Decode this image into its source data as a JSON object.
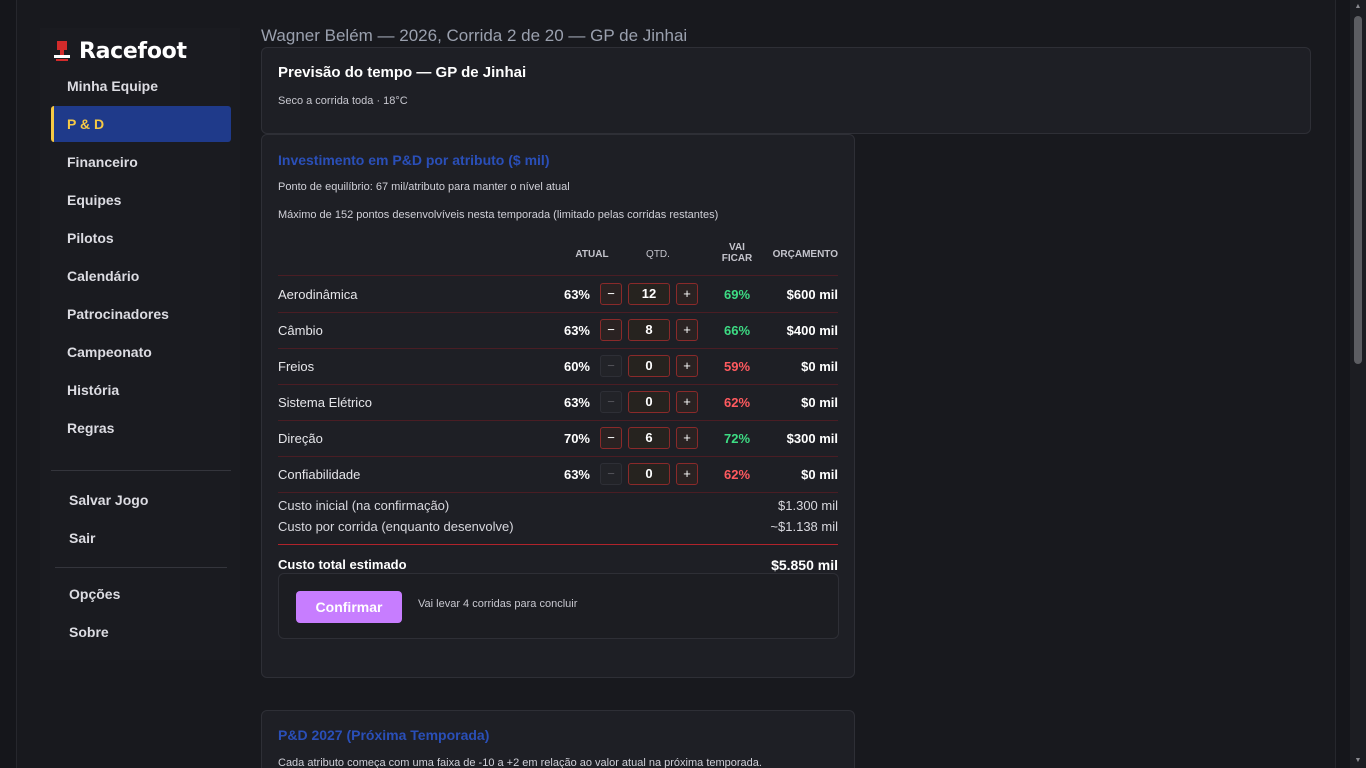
{
  "app": {
    "title": "Racefoot"
  },
  "sidebar": {
    "items": [
      {
        "label": "Minha Equipe"
      },
      {
        "label": "P & D"
      },
      {
        "label": "Financeiro"
      },
      {
        "label": "Equipes"
      },
      {
        "label": "Pilotos"
      },
      {
        "label": "Calendário"
      },
      {
        "label": "Patrocinadores"
      },
      {
        "label": "Campeonato"
      },
      {
        "label": "História"
      },
      {
        "label": "Regras"
      }
    ],
    "secondary": [
      {
        "label": "Salvar Jogo"
      },
      {
        "label": "Sair"
      }
    ],
    "tertiary": [
      {
        "label": "Opções"
      },
      {
        "label": "Sobre"
      }
    ]
  },
  "header": {
    "line": "Wagner Belém — 2026, Corrida 2 de 20 — GP de Jinhai"
  },
  "weather": {
    "title": "Previsão do tempo — GP de Jinhai",
    "text": "Seco a corrida toda · 18°C"
  },
  "rd": {
    "title": "Investimento em P&D por atributo ($ mil)",
    "note1": "Ponto de equilíbrio: 67 mil/atributo para manter o nível atual",
    "note2": "Máximo de 152 pontos desenvolvíveis nesta temporada (limitado pelas corridas restantes)",
    "columns": {
      "atual": "ATUAL",
      "qtd": "QTD.",
      "vai": "VAI",
      "ficar": "FICAR",
      "orcamento": "ORÇAMENTO"
    },
    "rows": [
      {
        "name": "Aerodinâmica",
        "current": "63%",
        "qty": "12",
        "will": "69%",
        "budget": "$600 mil"
      },
      {
        "name": "Câmbio",
        "current": "63%",
        "qty": "8",
        "will": "66%",
        "budget": "$400 mil"
      },
      {
        "name": "Freios",
        "current": "60%",
        "qty": "0",
        "will": "59%",
        "budget": "$0 mil"
      },
      {
        "name": "Sistema Elétrico",
        "current": "63%",
        "qty": "0",
        "will": "62%",
        "budget": "$0 mil"
      },
      {
        "name": "Direção",
        "current": "70%",
        "qty": "6",
        "will": "72%",
        "budget": "$300 mil"
      },
      {
        "name": "Confiabilidade",
        "current": "63%",
        "qty": "0",
        "will": "62%",
        "budget": "$0 mil"
      }
    ],
    "minus": "−",
    "plus": "+",
    "initial_cost_label": "Custo inicial (na confirmação)",
    "initial_cost_value": "$1.300 mil",
    "per_race_label": "Custo por corrida (enquanto desenvolve)",
    "per_race_value": "~$1.138 mil",
    "total_label": "Custo total estimado",
    "total_value": "$5.850 mil",
    "confirm_label": "Confirmar",
    "confirm_note": "Vai levar 4 corridas para concluir"
  },
  "next": {
    "title": "P&D 2027 (Próxima Temporada)",
    "text": "Cada atributo começa com uma faixa de -10 a +2 em relação ao valor atual na próxima temporada."
  },
  "colors": {
    "accent_blue": "#1f3a8a",
    "accent_yellow": "#f6c945",
    "up_green": "#3ddc84",
    "down_red": "#ff5a5f",
    "confirm_purple": "#c77dff"
  }
}
